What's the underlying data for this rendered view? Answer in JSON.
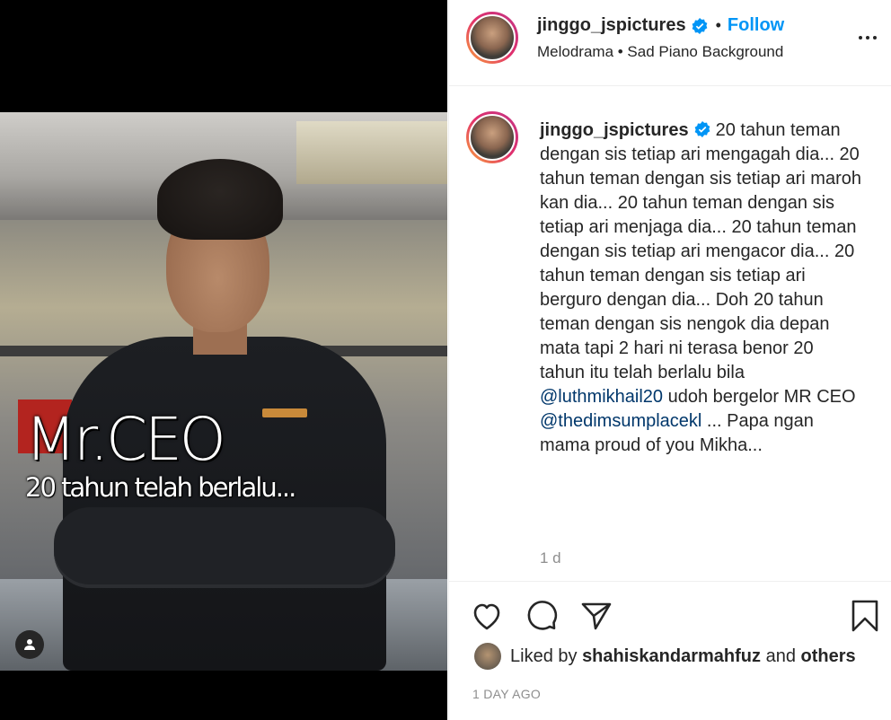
{
  "media": {
    "overlay_title": "Mr.CEO",
    "overlay_subtitle": "20 tahun telah berlalu..."
  },
  "header": {
    "username": "jinggo_jspictures",
    "separator": "•",
    "follow_label": "Follow",
    "music": "Melodrama • Sad Piano Background"
  },
  "caption": {
    "username": "jinggo_jspictures",
    "text_part1": "20 tahun teman dengan sis tetiap ari mengagah dia... 20 tahun teman dengan sis tetiap ari maroh kan dia... 20 tahun teman dengan sis tetiap ari menjaga dia... 20 tahun teman dengan sis tetiap ari mengacor dia... 20 tahun teman dengan sis tetiap ari berguro dengan dia... Doh 20 tahun teman dengan sis nengok dia depan mata tapi 2 hari ni terasa benor 20 tahun itu telah berlalu bila ",
    "mention1": "@luthmikhail20",
    "text_part2": " udoh bergelor MR CEO ",
    "mention2": "@thedimsumplacekl",
    "text_part3": " ... Papa ngan mama proud of you Mikha...",
    "time": "1 d"
  },
  "likes": {
    "prefix": "Liked by ",
    "liker": "shahiskandarmahfuz",
    "middle": " and ",
    "others": "others"
  },
  "timestamp": "1 DAY AGO",
  "icons": {
    "verified": "verified-badge-icon",
    "like": "heart-icon",
    "comment": "comment-icon",
    "share": "paper-plane-icon",
    "save": "bookmark-icon",
    "tag": "user-tag-icon",
    "more": "more-options-icon"
  },
  "colors": {
    "link": "#0095f6",
    "mention": "#00376b",
    "muted": "#8e8e8e",
    "text": "#262626"
  }
}
